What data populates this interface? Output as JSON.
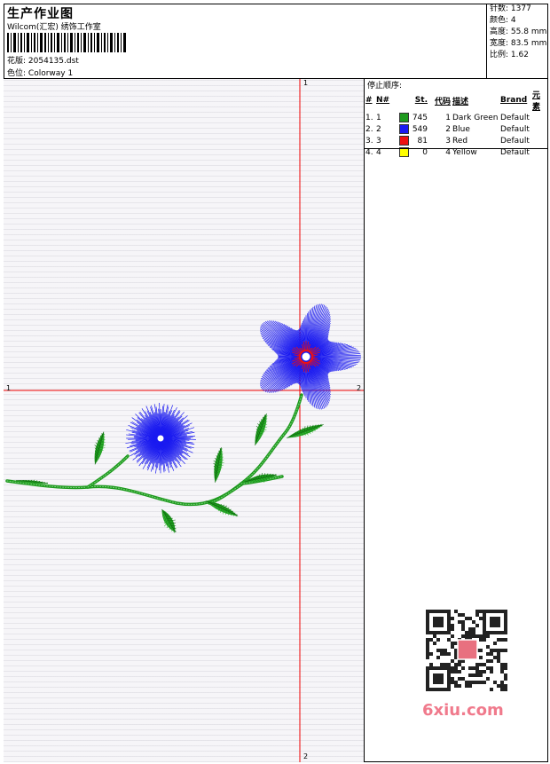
{
  "header": {
    "title": "生产作业图",
    "company": "Wilcom(汇宏) 绣饰工作室",
    "design_label": "花版:",
    "design_name": "2054135.dst",
    "colorway_label": "色位:",
    "colorway_name": "Colorway 1"
  },
  "stats": [
    {
      "label": "针数",
      "value": "1377"
    },
    {
      "label": "颜色",
      "value": "4"
    },
    {
      "label": "高度",
      "value": "55.8 mm"
    },
    {
      "label": "宽度",
      "value": "83.5 mm"
    },
    {
      "label": "比例",
      "value": "1.62"
    }
  ],
  "stop_sequence": {
    "title": "停止顺序:",
    "columns": [
      "#",
      "N#",
      "St.",
      "代码",
      "描述",
      "Brand",
      "元素"
    ],
    "rows": [
      {
        "num": "1.",
        "n": "1",
        "color": "#1e9a1e",
        "st": "745",
        "code": "1",
        "desc": "Dark Green",
        "brand": "Default",
        "element": ""
      },
      {
        "num": "2.",
        "n": "2",
        "color": "#1a1af0",
        "st": "549",
        "code": "2",
        "desc": "Blue",
        "brand": "Default",
        "element": ""
      },
      {
        "num": "3.",
        "n": "3",
        "color": "#ee1111",
        "st": "81",
        "code": "3",
        "desc": "Red",
        "brand": "Default",
        "element": ""
      },
      {
        "num": "4.",
        "n": "4",
        "color": "#ffff00",
        "st": "0",
        "code": "4",
        "desc": "Yellow",
        "brand": "Default",
        "element": ""
      }
    ]
  },
  "axes": {
    "top": "1",
    "bottom": "2",
    "left": "1",
    "right": "2"
  },
  "watermark": "6xiu.com",
  "colors": {
    "guide": "#ee0000",
    "green": "#1e9a1e",
    "blue": "#1a1af0",
    "red": "#ee1111"
  }
}
